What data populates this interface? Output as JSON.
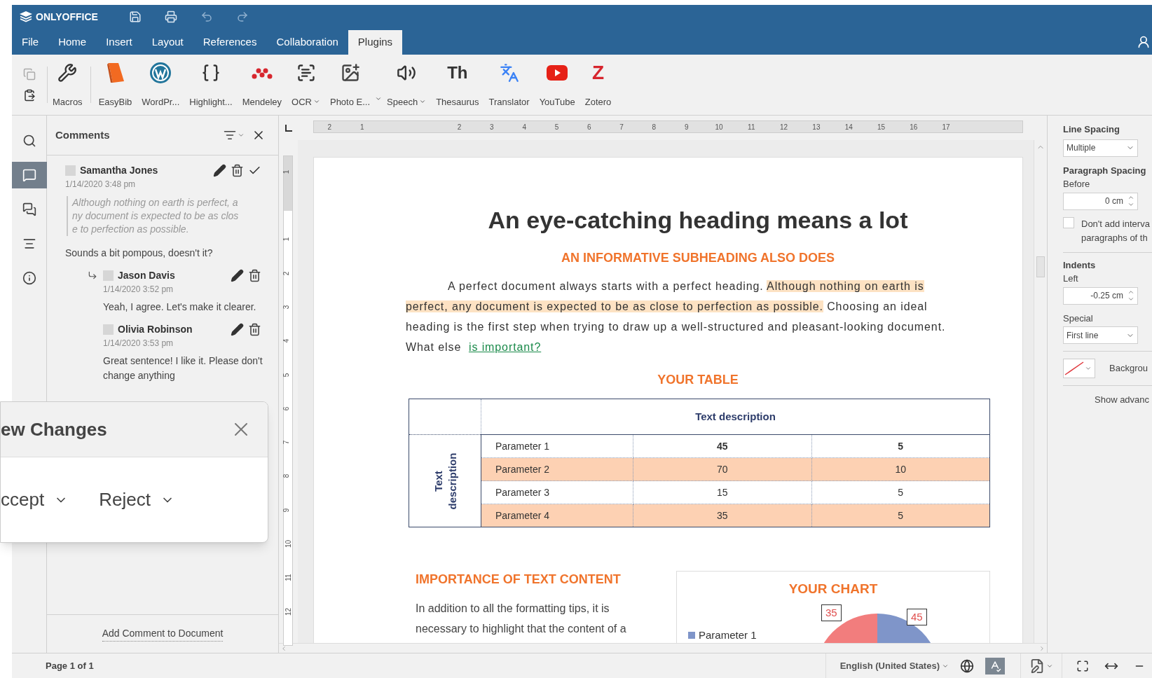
{
  "app": {
    "logo": "ONLYOFFICE"
  },
  "quick_actions": [
    {
      "kind": "save",
      "disabled": false
    },
    {
      "kind": "print",
      "disabled": false
    },
    {
      "kind": "undo",
      "disabled": true
    },
    {
      "kind": "redo",
      "disabled": true
    }
  ],
  "menu": [
    {
      "label": "File",
      "selected": false
    },
    {
      "label": "Home",
      "selected": false
    },
    {
      "label": "Insert",
      "selected": false
    },
    {
      "label": "Layout",
      "selected": false
    },
    {
      "label": "References",
      "selected": false
    },
    {
      "label": "Collaboration",
      "selected": false
    },
    {
      "label": "Plugins",
      "selected": true
    }
  ],
  "clipboard": [
    {
      "kind": "copy",
      "disabled": true
    },
    {
      "kind": "paste",
      "disabled": false
    }
  ],
  "toolbar": [
    {
      "kind": "macros",
      "label": "Macros",
      "dropdown": false
    },
    {
      "kind": "easybib",
      "label": "EasyBib",
      "dropdown": false
    },
    {
      "kind": "wordpress",
      "label": "WordPr...",
      "dropdown": false
    },
    {
      "kind": "highlight",
      "label": "Highlight...",
      "dropdown": false
    },
    {
      "kind": "mendeley",
      "label": "Mendeley",
      "dropdown": false
    },
    {
      "kind": "ocr",
      "label": "OCR",
      "dropdown": true
    },
    {
      "kind": "photo",
      "label": "Photo E...",
      "dropdown": true
    },
    {
      "kind": "speech",
      "label": "Speech",
      "dropdown": true
    },
    {
      "kind": "thesaurus",
      "label": "Thesaurus",
      "glyph": "Th",
      "dropdown": false
    },
    {
      "kind": "translator",
      "label": "Translator",
      "dropdown": false
    },
    {
      "kind": "youtube",
      "label": "YouTube",
      "dropdown": false
    },
    {
      "kind": "zotero",
      "label": "Zotero",
      "glyph": "Z",
      "dropdown": false
    }
  ],
  "sidebar": [
    {
      "kind": "search",
      "selected": false
    },
    {
      "kind": "comments",
      "selected": true
    },
    {
      "kind": "chat",
      "selected": false
    },
    {
      "kind": "navigation",
      "selected": false
    },
    {
      "kind": "info",
      "selected": false
    }
  ],
  "comments": {
    "title": "Comments",
    "threads": [
      {
        "author": "Samantha Jones",
        "date": "1/14/2020 3:48 pm",
        "quote": [
          "Although nothing on earth is perfect, a",
          "ny document is expected to be as clos",
          "e to perfection as possible."
        ],
        "text": "Sounds a bit pompous, doesn't it?",
        "resolvable": true,
        "replies": [
          {
            "author": "Jason Davis",
            "date": "1/14/2020 3:52 pm",
            "text": "Yeah, I agree. Let's make it clearer."
          },
          {
            "author": "Olivia Robinson",
            "date": "1/14/2020 3:53 pm",
            "text": "Great sentence! I like it. Please don't change anything"
          }
        ]
      }
    ],
    "add_link": "Add Comment to Document"
  },
  "review_popup": {
    "title": "ew Changes",
    "actions": [
      "ccept",
      "Reject"
    ]
  },
  "rulers": {
    "horizontal_before": [
      "2",
      "1"
    ],
    "horizontal_after": [
      "2",
      "3",
      "4",
      "5",
      "6",
      "7",
      "8",
      "9",
      "10",
      "11",
      "12",
      "13",
      "14",
      "15",
      "16",
      "17"
    ],
    "vertical_before": [
      "1"
    ],
    "vertical_after": [
      "1",
      "2",
      "3",
      "4",
      "5",
      "6",
      "7",
      "8",
      "9",
      "10",
      "11",
      "12"
    ]
  },
  "document": {
    "heading": "An eye-catching heading means a lot",
    "subheading": "AN INFORMATIVE SUBHEADING ALSO DOES",
    "paragraph": [
      {
        "kind": "plain",
        "text": "A perfect document always starts with a perfect heading. "
      },
      {
        "kind": "highlight",
        "text": "Although nothing on earth is perfect, any document is expected to be as close to perfection as possible."
      },
      {
        "kind": "plain",
        "text": " Choosing an ideal heading is the first step when trying to draw up a well-structured and pleasant-looking document. What else  "
      },
      {
        "kind": "link",
        "text": "is important?"
      }
    ],
    "table_title": "YOUR TABLE",
    "table": {
      "header": "Text description",
      "row_header": "Text description",
      "rows": [
        {
          "cells": [
            "Parameter 1",
            "45",
            "5"
          ],
          "shaded": false
        },
        {
          "cells": [
            "Parameter 2",
            "70",
            "10"
          ],
          "shaded": true
        },
        {
          "cells": [
            "Parameter 3",
            "15",
            "5"
          ],
          "shaded": false
        },
        {
          "cells": [
            "Parameter 4",
            "35",
            "5"
          ],
          "shaded": true
        }
      ]
    },
    "section_title": "IMPORTANCE OF TEXT CONTENT",
    "section_lines": [
      "In addition to all the formatting tips, it is",
      "necessary to highlight that the content of a"
    ],
    "chart": {
      "title": "YOUR CHART",
      "legend": [
        {
          "label": "Parameter 1",
          "color": "#7f95c9"
        }
      ],
      "labels": [
        "35",
        "45"
      ]
    }
  },
  "format_panel": {
    "line_spacing_label": "Line Spacing",
    "line_spacing_value": "Multiple",
    "paragraph_spacing_label": "Paragraph Spacing",
    "before_label": "Before",
    "before_value": "0 cm",
    "dont_add": {
      "checked": false,
      "lines": [
        "Don't add interva",
        "paragraphs of th"
      ]
    },
    "indents_label": "Indents",
    "left_label": "Left",
    "left_value": "-0.25 cm",
    "special_label": "Special",
    "special_value": "First line",
    "background_label": "Backgrou",
    "advanced_link": "Show advanc"
  },
  "status_bar": {
    "page": "Page 1 of 1",
    "language": "English (United States)",
    "spellcheck_on": true
  }
}
